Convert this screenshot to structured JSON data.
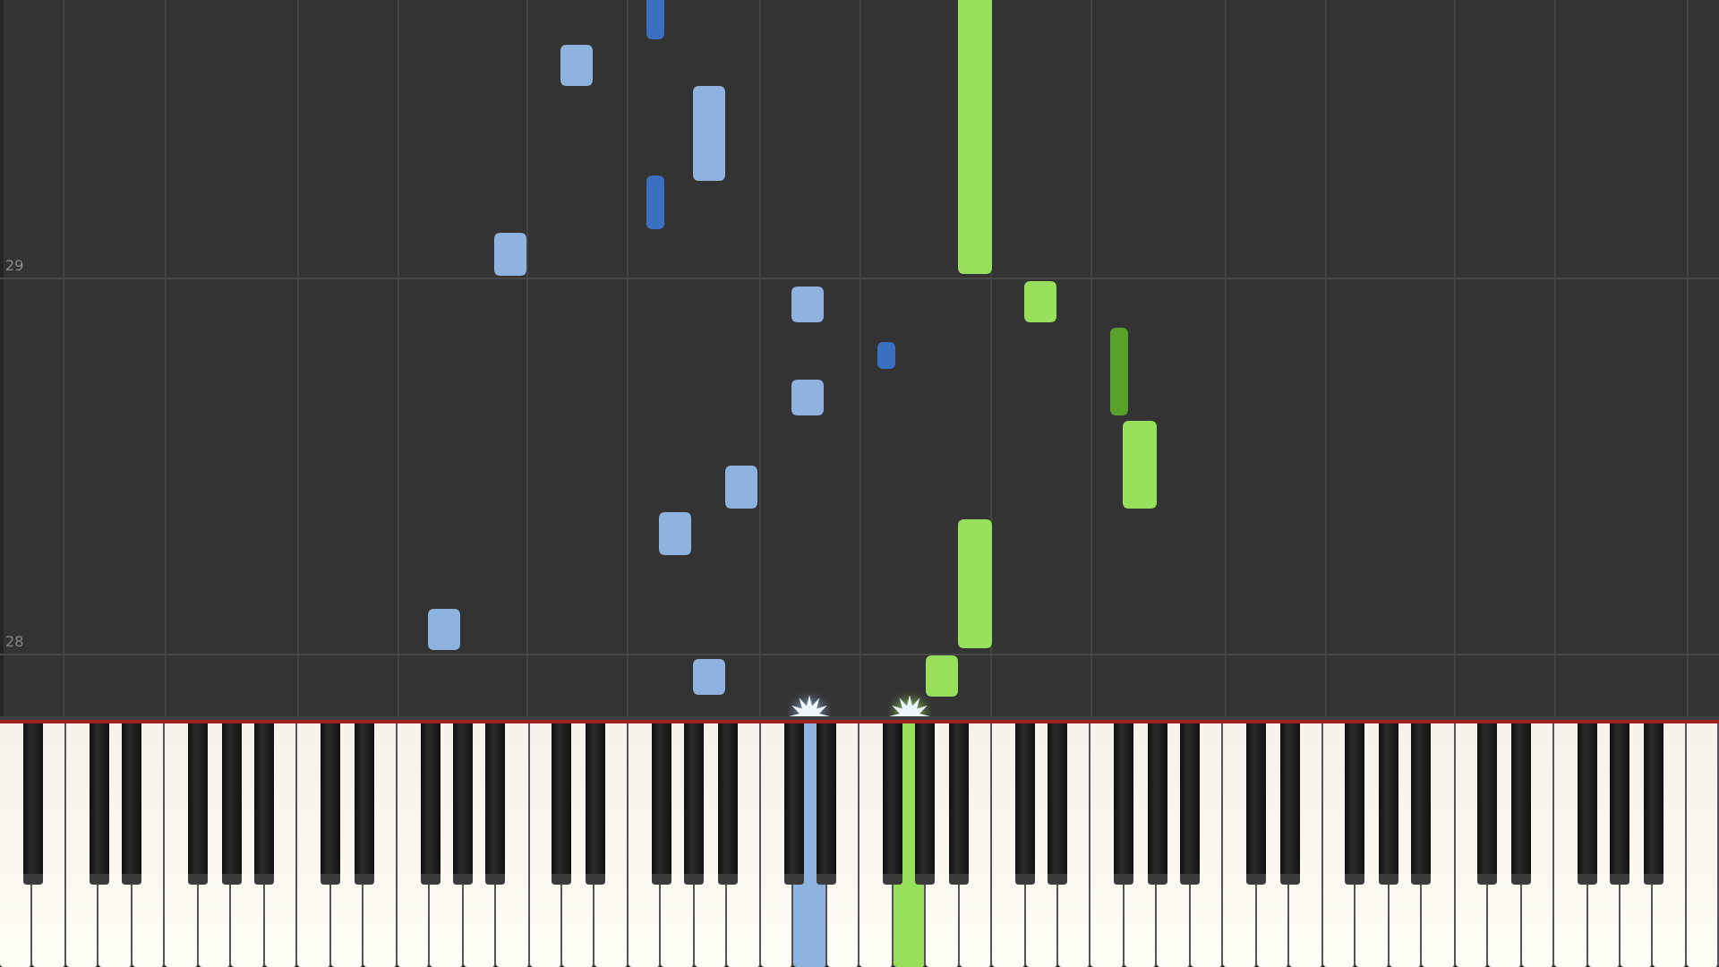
{
  "roll": {
    "measures": [
      {
        "label": "29"
      },
      {
        "label": "28"
      }
    ],
    "notes": [
      {
        "color": "#3b6fbf"
      },
      {
        "color": "#8fb3df"
      },
      {
        "color": "#8fb3df"
      },
      {
        "color": "#3b6fbf"
      },
      {
        "color": "#8fb3df"
      },
      {
        "color": "#8fb3df"
      },
      {
        "color": "#3b6fbf"
      },
      {
        "color": "#8fb3df"
      },
      {
        "color": "#8fb3df"
      },
      {
        "color": "#8fb3df"
      },
      {
        "color": "#8fb3df"
      },
      {
        "color": "#8fb3df"
      },
      {
        "color": "#98e05c"
      },
      {
        "color": "#98e05c"
      },
      {
        "color": "#5aa12b"
      },
      {
        "color": "#98e05c"
      },
      {
        "color": "#98e05c"
      },
      {
        "color": "#98e05c"
      }
    ]
  },
  "keyboard": {
    "white_keys": [
      {
        "pressed": false
      },
      {
        "pressed": false
      },
      {
        "pressed": false
      },
      {
        "pressed": false
      },
      {
        "pressed": false
      },
      {
        "pressed": false
      },
      {
        "pressed": false
      },
      {
        "pressed": false
      },
      {
        "pressed": false
      },
      {
        "pressed": false
      },
      {
        "pressed": false
      },
      {
        "pressed": false
      },
      {
        "pressed": false
      },
      {
        "pressed": false
      },
      {
        "pressed": false
      },
      {
        "pressed": false
      },
      {
        "pressed": false
      },
      {
        "pressed": false
      },
      {
        "pressed": false
      },
      {
        "pressed": false
      },
      {
        "pressed": false
      },
      {
        "pressed": false
      },
      {
        "pressed": false
      },
      {
        "pressed": false
      },
      {
        "pressed": true,
        "color": "#8fb3df"
      },
      {
        "pressed": false
      },
      {
        "pressed": false
      },
      {
        "pressed": true,
        "color": "#98e05c"
      },
      {
        "pressed": false
      },
      {
        "pressed": false
      },
      {
        "pressed": false
      },
      {
        "pressed": false
      },
      {
        "pressed": false
      },
      {
        "pressed": false
      },
      {
        "pressed": false
      },
      {
        "pressed": false
      },
      {
        "pressed": false
      },
      {
        "pressed": false
      },
      {
        "pressed": false
      },
      {
        "pressed": false
      },
      {
        "pressed": false
      },
      {
        "pressed": false
      },
      {
        "pressed": false
      },
      {
        "pressed": false
      },
      {
        "pressed": false
      },
      {
        "pressed": false
      },
      {
        "pressed": false
      },
      {
        "pressed": false
      },
      {
        "pressed": false
      },
      {
        "pressed": false
      },
      {
        "pressed": false
      },
      {
        "pressed": false
      }
    ]
  }
}
